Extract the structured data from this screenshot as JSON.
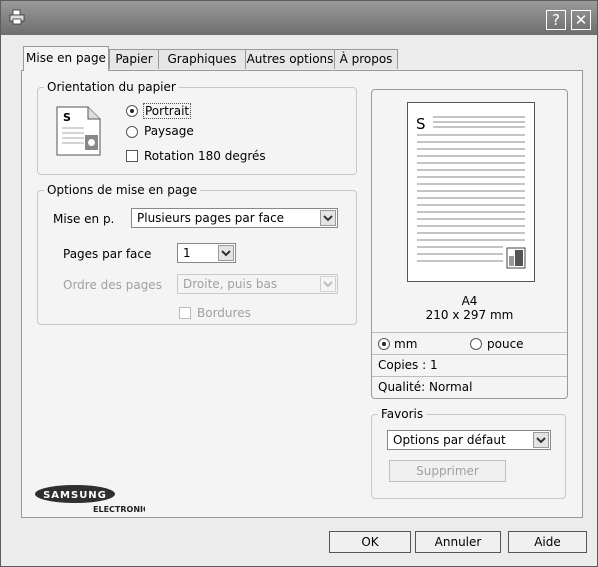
{
  "window": {
    "help_button": "?",
    "close_button": "✕"
  },
  "tabs": [
    {
      "label": "Mise en page"
    },
    {
      "label": "Papier"
    },
    {
      "label": "Graphiques"
    },
    {
      "label": "Autres options"
    },
    {
      "label": "À propos"
    }
  ],
  "orientation": {
    "title": "Orientation du papier",
    "portrait": "Portrait",
    "paysage": "Paysage",
    "rotation": "Rotation 180 degrés",
    "selected": "portrait",
    "rotation_checked": false,
    "icon_letter": "S"
  },
  "layout_options": {
    "title": "Options de mise en page",
    "mise_label": "Mise en p.",
    "mise_value": "Plusieurs pages par face",
    "pages_label": "Pages par face",
    "pages_value": "1",
    "order_label": "Ordre des pages",
    "order_value": "Droite, puis bas",
    "borders_label": "Bordures",
    "borders_checked": false
  },
  "preview": {
    "letter": "S",
    "paper": "A4",
    "size": "210 x 297 mm",
    "unit_mm": "mm",
    "unit_inch": "pouce",
    "unit_selected": "mm",
    "copies": "Copies : 1",
    "quality": "Qualité: Normal"
  },
  "favorites": {
    "title": "Favoris",
    "value": "Options par défaut",
    "delete_button": "Supprimer"
  },
  "logo": {
    "brand": "SAMSUNG",
    "sub": "ELECTRONICS"
  },
  "footer": {
    "ok": "OK",
    "cancel": "Annuler",
    "help": "Aide"
  }
}
